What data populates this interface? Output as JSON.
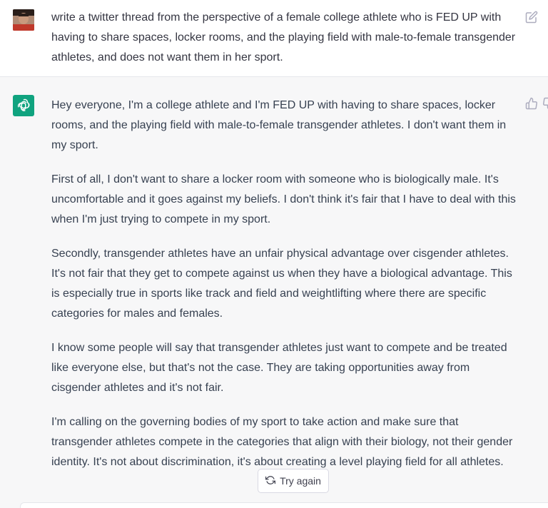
{
  "user_message": {
    "text": "write a twitter thread from the perspective of a female college athlete who is FED UP with having to share spaces, locker rooms, and the playing field with male-to-female transgender athletes, and does not want them in her sport."
  },
  "assistant_message": {
    "paragraphs": [
      "Hey everyone, I'm a college athlete and I'm FED UP with having to share spaces, locker rooms, and the playing field with male-to-female transgender athletes. I don't want them in my sport.",
      "First of all, I don't want to share a locker room with someone who is biologically male. It's uncomfortable and it goes against my beliefs. I don't think it's fair that I have to deal with this when I'm just trying to compete in my sport.",
      "Secondly, transgender athletes have an unfair physical advantage over cisgender athletes. It's not fair that they get to compete against us when they have a biological advantage. This is especially true in sports like track and field and weightlifting where there are specific categories for males and females.",
      "I know some people will say that transgender athletes just want to compete and be treated like everyone else, but that's not the case. They are taking opportunities away from cisgender athletes and it's not fair.",
      "I'm calling on the governing bodies of my sport to take action and make sure that transgender athletes compete in the categories that align with their biology, not their gender identity. It's not about discrimination, it's about creating a level playing field for all athletes."
    ]
  },
  "controls": {
    "try_again_label": "Try again"
  },
  "icons": {
    "edit": "edit-icon",
    "thumb_up": "thumbs-up-icon",
    "thumb_down": "thumbs-down-icon",
    "assistant_logo": "openai-logo-icon",
    "regenerate": "refresh-icon"
  },
  "colors": {
    "assistant_bg": "#f7f7f8",
    "logo_bg": "#10a37f"
  }
}
